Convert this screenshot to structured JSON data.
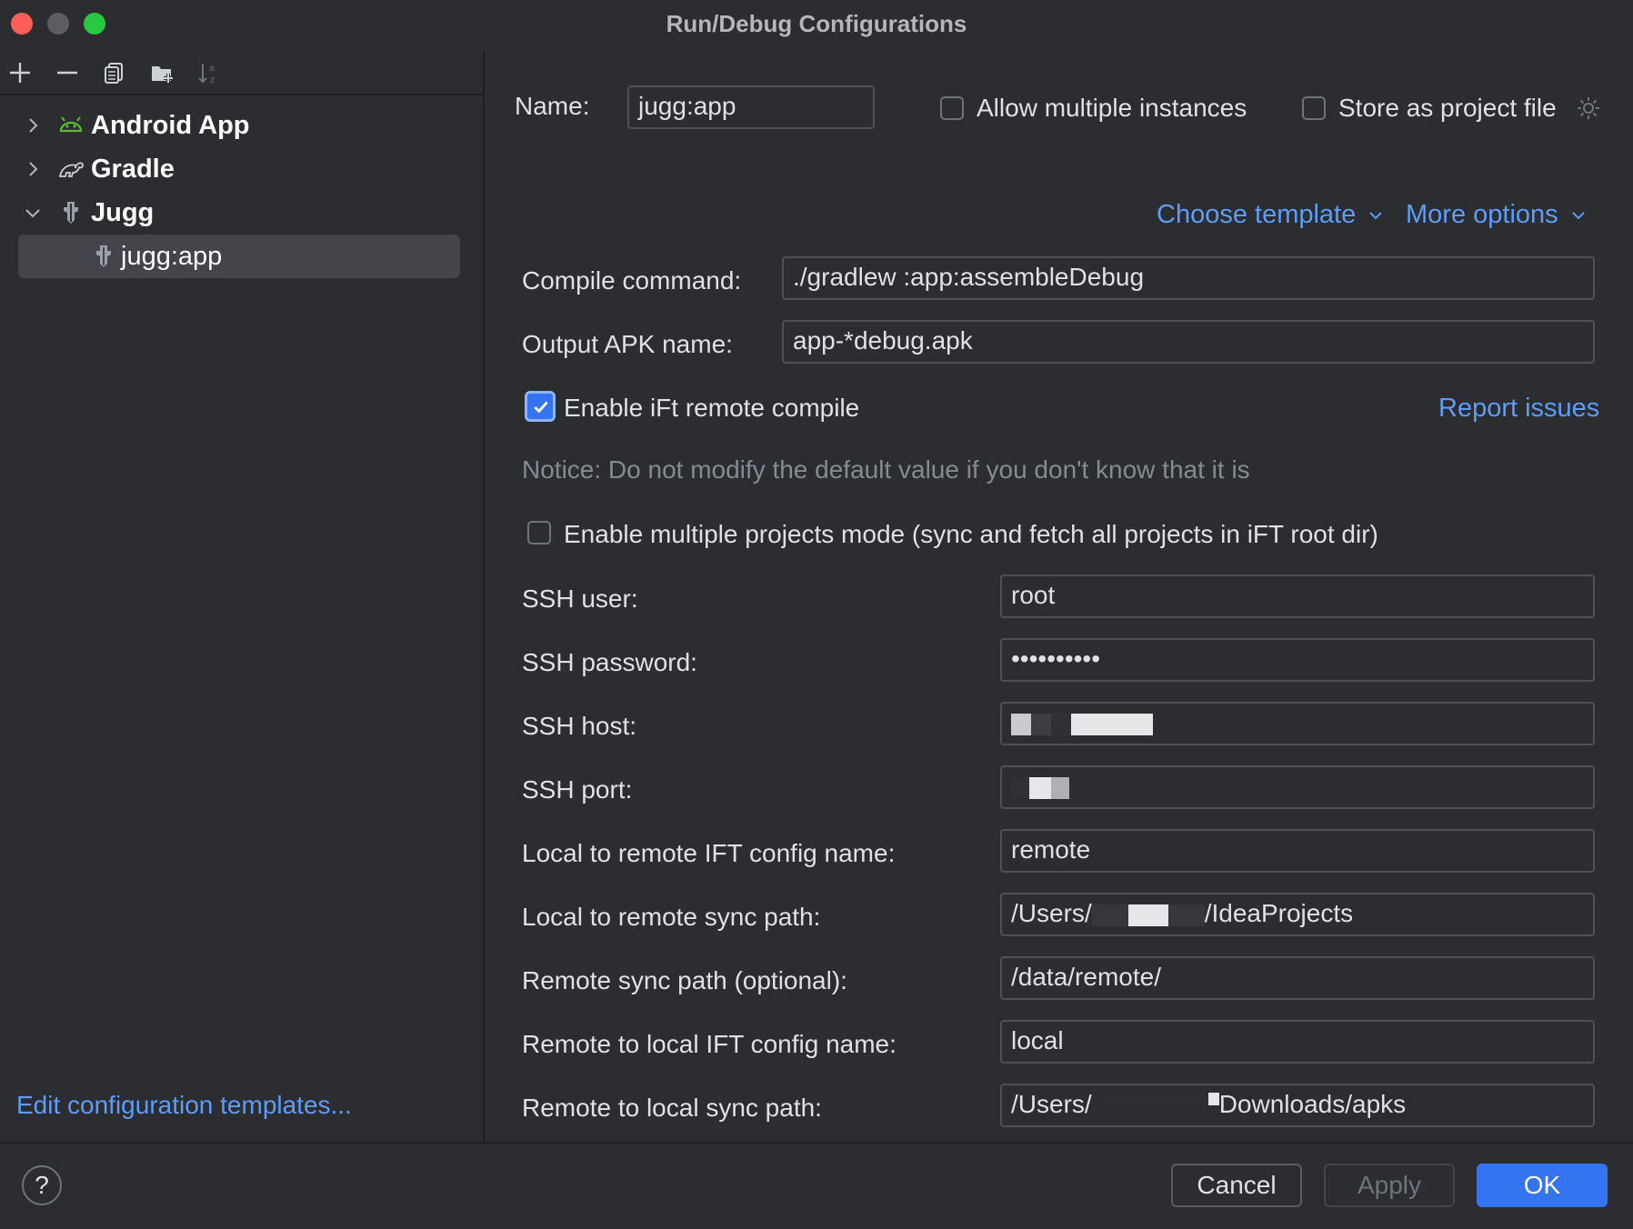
{
  "window": {
    "title": "Run/Debug Configurations"
  },
  "toolbar": {
    "icons": [
      "add-icon",
      "remove-icon",
      "copy-icon",
      "new-folder-icon",
      "sort-icon"
    ]
  },
  "tree": {
    "items": [
      {
        "label": "Android App",
        "icon": "android-icon",
        "expanded": false
      },
      {
        "label": "Gradle",
        "icon": "gradle-icon",
        "expanded": false
      },
      {
        "label": "Jugg",
        "icon": "jugg-icon",
        "expanded": true
      },
      {
        "label": "jugg:app",
        "icon": "jugg-icon",
        "selected": true
      }
    ]
  },
  "left_footer": {
    "edit_templates": "Edit configuration templates..."
  },
  "form": {
    "name_label": "Name:",
    "name_value": "jugg:app",
    "allow_multiple": {
      "label": "Allow multiple instances",
      "checked": false
    },
    "store_project": {
      "label": "Store as project file",
      "checked": false
    },
    "choose_template": "Choose template",
    "more_options": "More options",
    "compile_command": {
      "label": "Compile command:",
      "value": "./gradlew :app:assembleDebug"
    },
    "output_apk": {
      "label": "Output APK name:",
      "value": "app-*debug.apk"
    },
    "enable_remote": {
      "label": "Enable iFt remote compile",
      "checked": true
    },
    "report_issues": "Report issues",
    "notice": "Notice: Do not modify the default value if you don't know that it is",
    "multi_project": {
      "label": "Enable multiple projects mode (sync and fetch all projects in iFT root dir)",
      "checked": false
    },
    "ssh_user": {
      "label": "SSH user:",
      "value": "root"
    },
    "ssh_password": {
      "label": "SSH password:",
      "value": "••••••••••"
    },
    "ssh_host": {
      "label": "SSH host:"
    },
    "ssh_port": {
      "label": "SSH port:"
    },
    "l2r_config": {
      "label": "Local to remote IFT config name:",
      "value": "remote"
    },
    "l2r_path": {
      "label": "Local to remote sync path:",
      "prefix": "/Users/",
      "suffix": "/IdeaProjects"
    },
    "remote_sync": {
      "label": "Remote sync path (optional):",
      "value": "/data/remote/"
    },
    "r2l_config": {
      "label": "Remote to local IFT config name:",
      "value": "local"
    },
    "r2l_path": {
      "label": "Remote to local sync path:",
      "prefix": "/Users/",
      "suffix": "Downloads/apks"
    }
  },
  "buttons": {
    "help": "?",
    "cancel": "Cancel",
    "apply": "Apply",
    "ok": "OK"
  },
  "colors": {
    "accent": "#3574f0",
    "link": "#5e9cf5",
    "background": "#2b2d30"
  }
}
